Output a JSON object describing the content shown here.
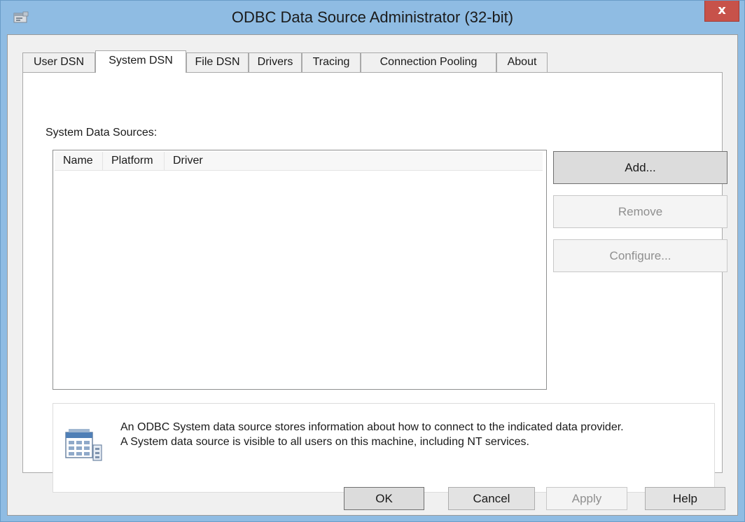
{
  "window": {
    "title": "ODBC Data Source Administrator (32-bit)",
    "close_label": "x"
  },
  "tabs": [
    {
      "label": "User DSN",
      "active": false
    },
    {
      "label": "System DSN",
      "active": true
    },
    {
      "label": "File DSN",
      "active": false
    },
    {
      "label": "Drivers",
      "active": false
    },
    {
      "label": "Tracing",
      "active": false
    },
    {
      "label": "Connection Pooling",
      "active": false
    },
    {
      "label": "About",
      "active": false
    }
  ],
  "panel": {
    "sources_label": "System Data Sources:",
    "columns": [
      "Name",
      "Platform",
      "Driver"
    ],
    "rows": []
  },
  "side_buttons": {
    "add": "Add...",
    "remove": "Remove",
    "configure": "Configure..."
  },
  "info": {
    "line1": "An ODBC System data source stores information about how to connect to the indicated data provider.",
    "line2": "A System data source is visible to all users on this machine, including NT services."
  },
  "footer_buttons": {
    "ok": "OK",
    "cancel": "Cancel",
    "apply": "Apply",
    "help": "Help"
  },
  "colors": {
    "title_bar": "#8fbce3",
    "close_button": "#c7524a",
    "dialog_background": "#f0f0f0"
  },
  "icons": {
    "app": "odbc-app-icon",
    "close": "close-icon",
    "info": "data-source-grid-icon"
  }
}
